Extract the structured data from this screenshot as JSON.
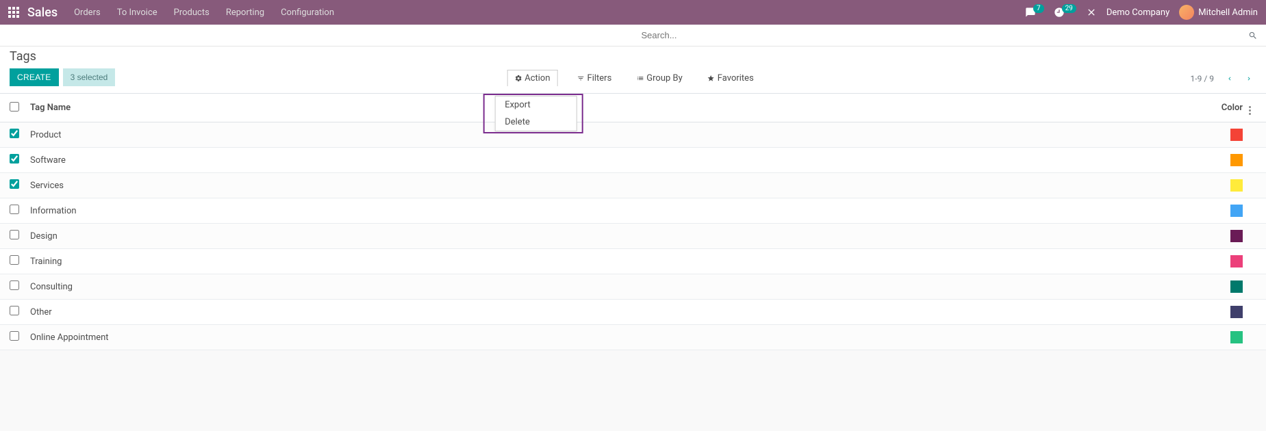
{
  "navbar": {
    "brand": "Sales",
    "links": [
      "Orders",
      "To Invoice",
      "Products",
      "Reporting",
      "Configuration"
    ],
    "chat_badge": "7",
    "activity_badge": "29",
    "company": "Demo Company",
    "user": "Mitchell Admin"
  },
  "search": {
    "placeholder": "Search..."
  },
  "page": {
    "title": "Tags",
    "create_label": "CREATE",
    "selected_label": "3 selected",
    "action_label": "Action",
    "filters_label": "Filters",
    "groupby_label": "Group By",
    "favorites_label": "Favorites",
    "pager": "1-9 / 9"
  },
  "dropdown": {
    "items": [
      "Export",
      "Delete"
    ]
  },
  "table": {
    "col_name": "Tag Name",
    "col_color": "Color",
    "rows": [
      {
        "checked": true,
        "name": "Product",
        "color": "#f44336"
      },
      {
        "checked": true,
        "name": "Software",
        "color": "#ff9800"
      },
      {
        "checked": true,
        "name": "Services",
        "color": "#ffeb3b"
      },
      {
        "checked": false,
        "name": "Information",
        "color": "#42a5f5"
      },
      {
        "checked": false,
        "name": "Design",
        "color": "#6a1b56"
      },
      {
        "checked": false,
        "name": "Training",
        "color": "#ec407a"
      },
      {
        "checked": false,
        "name": "Consulting",
        "color": "#00796b"
      },
      {
        "checked": false,
        "name": "Other",
        "color": "#3f3f6b"
      },
      {
        "checked": false,
        "name": "Online Appointment",
        "color": "#26c281"
      }
    ]
  }
}
